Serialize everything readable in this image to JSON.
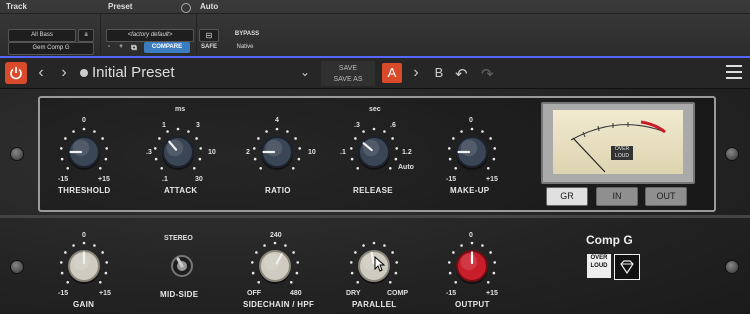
{
  "host": {
    "track_label": "Track",
    "preset_label": "Preset",
    "auto_label": "Auto",
    "track_name": "All Bass",
    "track_btn": "a",
    "insert_name": "Gem Comp G",
    "preset_value": "<factory default>",
    "compare": "COMPARE",
    "bypass": "BYPASS",
    "safe": "SAFE",
    "native": "Native",
    "minus": "-",
    "plus": "+"
  },
  "toolbar": {
    "preset_name": "Initial Preset",
    "save": "SAVE",
    "save_as": "SAVE AS",
    "a": "A",
    "b": "B"
  },
  "upper": {
    "threshold": {
      "label": "THRESHOLD",
      "top": "0",
      "min": "-15",
      "max": "+15"
    },
    "attack": {
      "label": "ATTACK",
      "unit": "ms",
      "t1": "1",
      "t2": "3",
      "t3": ".3",
      "t4": "10",
      "t5": ".1",
      "t6": "30"
    },
    "ratio": {
      "label": "RATIO",
      "top": "4",
      "min": "2",
      "max": "10"
    },
    "release": {
      "label": "RELEASE",
      "unit": "sec",
      "t1": ".3",
      "t2": ".6",
      "t3": ".1",
      "t4": "1.2",
      "t5": "Auto"
    },
    "makeup": {
      "label": "MAKE-UP",
      "top": "0",
      "min": "-15",
      "max": "+15"
    }
  },
  "meter": {
    "gr": "GR",
    "in": "IN",
    "out": "OUT",
    "logo": "OVER LOUD"
  },
  "lower": {
    "gain": {
      "label": "GAIN",
      "top": "0",
      "min": "-15",
      "max": "+15"
    },
    "midside": {
      "label": "MID-SIDE",
      "top": "STEREO"
    },
    "sidechain": {
      "label": "SIDECHAIN / HPF",
      "top": "240",
      "min": "OFF",
      "max": "480"
    },
    "parallel": {
      "label": "PARALLEL",
      "min": "DRY",
      "max": "COMP"
    },
    "output": {
      "label": "OUTPUT",
      "top": "0",
      "min": "-15",
      "max": "+15"
    }
  },
  "brand": {
    "name": "Comp G",
    "logo": "OVER LOUD"
  },
  "colors": {
    "accent": "#d94a2a",
    "host_blue": "#3b7bbf",
    "output_knob": "#c81e2a"
  }
}
